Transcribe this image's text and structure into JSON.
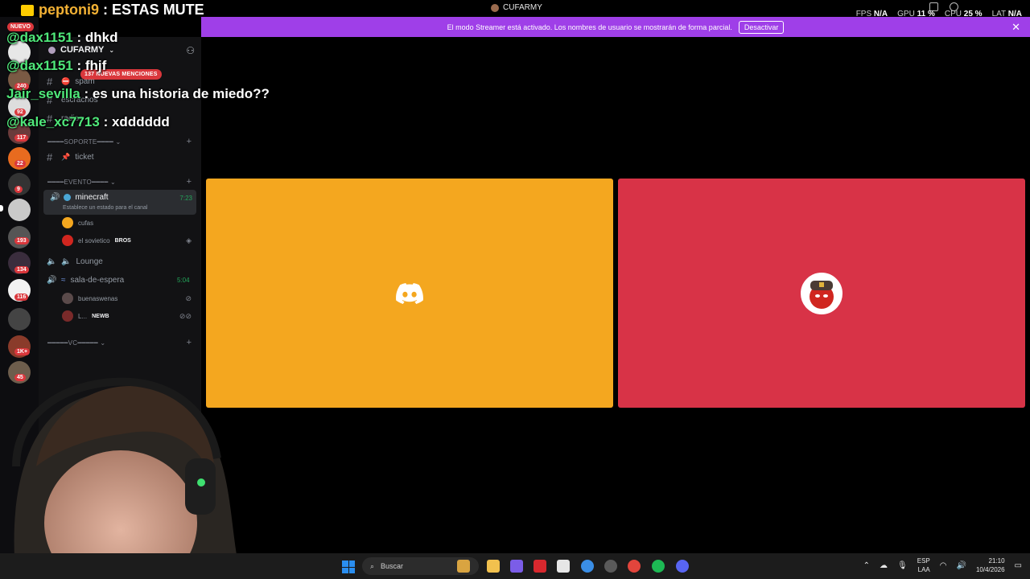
{
  "stream_overlay": {
    "title_user": "peptoni9",
    "title_text": ": ESTAS MUTE",
    "chat": [
      {
        "user": "@dax1151",
        "message": ": dhkd"
      },
      {
        "user": "@dax1151",
        "message": ": fhjf"
      },
      {
        "user": "Jair_sevilla",
        "message": ": es una historia de miedo??"
      },
      {
        "user": "@kale_xc7713",
        "message": ": xdddddd"
      }
    ]
  },
  "titlebar": {
    "server_title": "CUFARMY",
    "stats": [
      {
        "label": "FPS",
        "value": "N/A"
      },
      {
        "label": "GPU",
        "value": "11 %"
      },
      {
        "label": "CPU",
        "value": "25 %"
      },
      {
        "label": "LAT",
        "value": "N/A"
      }
    ]
  },
  "banner": {
    "text": "El modo Streamer está activado. Los nombres de usuario se mostrarán de forma parcial.",
    "button": "Desactivar"
  },
  "rail": {
    "new_badge": "NUEVO",
    "counts": [
      "240",
      "92",
      "117",
      "22",
      "9",
      "193",
      "134",
      "116",
      "1K+",
      "45"
    ]
  },
  "sidebar": {
    "server_name": "CUFARMY",
    "mentions_badge": "137 NUEVAS MENCIONES",
    "channels_top": [
      {
        "name": "spam"
      },
      {
        "name": "escrachos"
      },
      {
        "name": "radios"
      }
    ],
    "category_soporte": "SOPORTE",
    "ticket": "ticket",
    "category_evento": "EVENTO",
    "voice_active": {
      "name": "minecraft",
      "timer": "7:23",
      "status": "Establece un estado para el canal"
    },
    "members_minecraft": [
      {
        "name": "cufas",
        "tag": ""
      },
      {
        "name": "el sovietico",
        "tag": "BROS"
      }
    ],
    "lounge": "Lounge",
    "sala": {
      "name": "sala-de-espera",
      "timer": "5:04"
    },
    "members_sala": [
      {
        "name": "buenaswenas",
        "tag": ""
      },
      {
        "name": "L...",
        "tag": "NEWB"
      }
    ],
    "category_vc": "VC"
  },
  "taskbar": {
    "search_placeholder": "Buscar",
    "lang_top": "ESP",
    "lang_bottom": "LAA",
    "time": "21:10",
    "date": "10/4/2026"
  },
  "colors": {
    "tile_a": "#f4a71f",
    "tile_b": "#d83347",
    "banner": "#9f3fe8",
    "chat_user": "#4fe87a",
    "badge_red": "#da373c",
    "voice_green": "#23a55a"
  }
}
